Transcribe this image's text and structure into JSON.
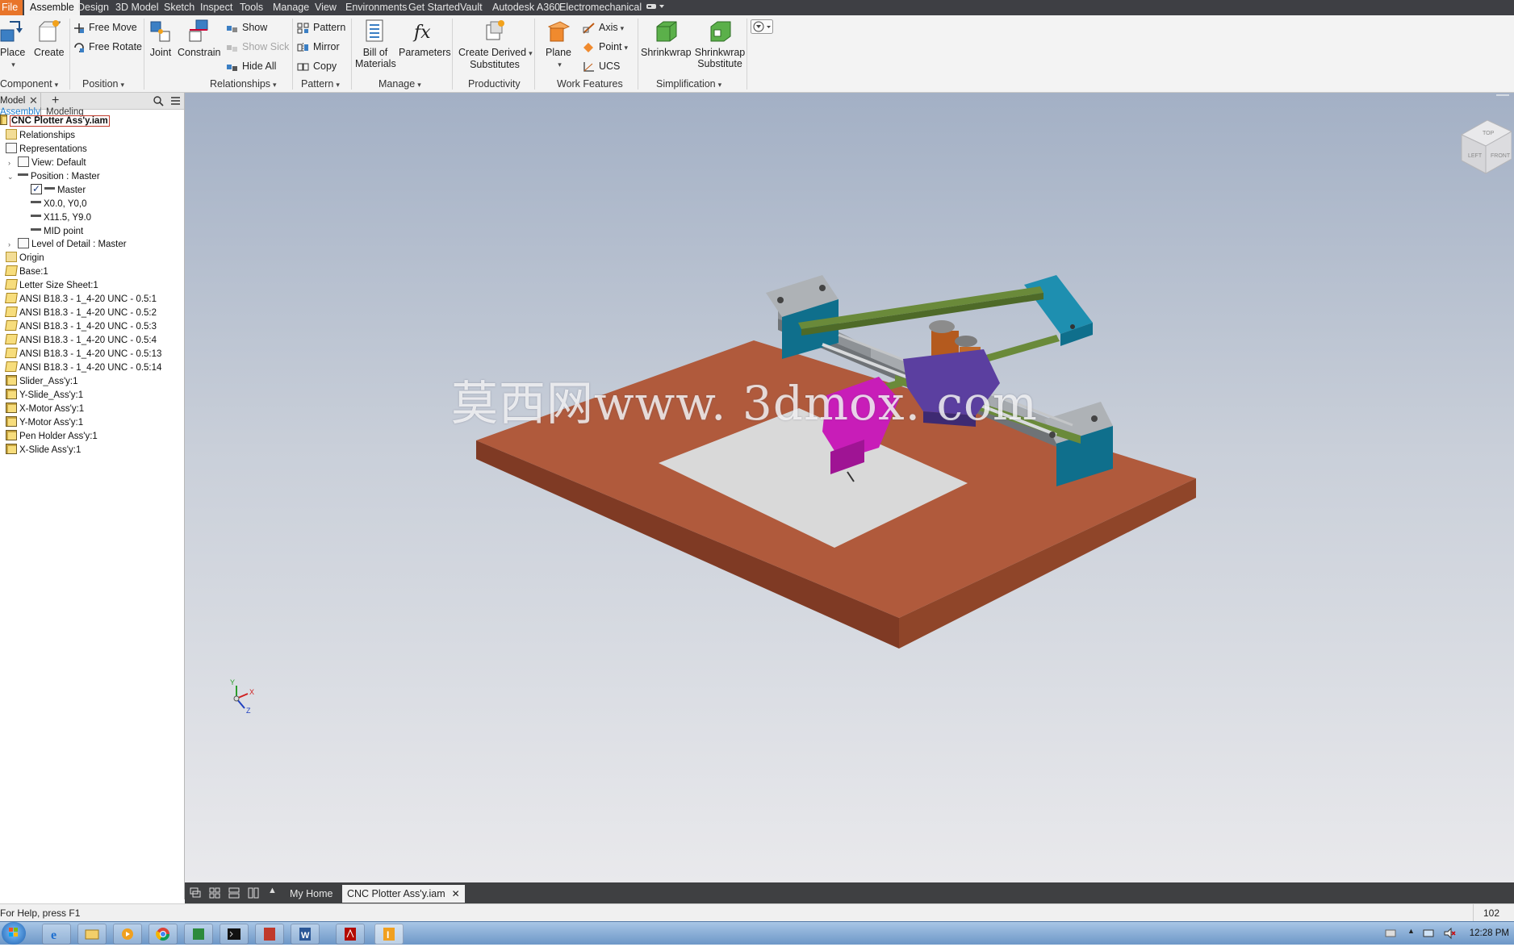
{
  "menu": {
    "tabs": [
      "File",
      "Assemble",
      "Design",
      "3D Model",
      "Sketch",
      "Inspect",
      "Tools",
      "Manage",
      "View",
      "Environments",
      "Get Started",
      "Vault",
      "Autodesk A360",
      "Electromechanical"
    ],
    "active": "Assemble"
  },
  "ribbon": {
    "component": {
      "place": "Place",
      "create": "Create",
      "group": "Component"
    },
    "position": {
      "free_move": "Free Move",
      "free_rotate": "Free Rotate",
      "group": "Position"
    },
    "relationships": {
      "joint": "Joint",
      "constrain": "Constrain",
      "show": "Show",
      "show_sick": "Show Sick",
      "hide_all": "Hide All",
      "group": "Relationships"
    },
    "pattern": {
      "pattern": "Pattern",
      "mirror": "Mirror",
      "copy": "Copy",
      "group": "Pattern"
    },
    "manage": {
      "bom_line1": "Bill of",
      "bom_line2": "Materials",
      "parameters": "Parameters",
      "group": "Manage"
    },
    "productivity": {
      "cds_line1": "Create Derived",
      "cds_line2": "Substitutes",
      "group": "Productivity"
    },
    "work_features": {
      "plane": "Plane",
      "axis": "Axis",
      "point": "Point",
      "ucs": "UCS",
      "group": "Work Features"
    },
    "simplification": {
      "shrinkwrap": "Shrinkwrap",
      "sws_line1": "Shrinkwrap",
      "sws_line2": "Substitute",
      "group": "Simplification"
    }
  },
  "browser": {
    "tab_label": "Model",
    "sub_assembly": "Assembly",
    "sub_modeling": "Modeling",
    "root": "CNC Plotter Ass'y.iam",
    "items": [
      "Relationships",
      "Representations",
      "View: Default",
      "Position : Master",
      "Master",
      "X0.0, Y0,0",
      "X11.5, Y9.0",
      "MID point",
      "Level of Detail : Master",
      "Origin",
      "Base:1",
      "Letter Size Sheet:1",
      "ANSI B18.3 - 1_4-20 UNC - 0.5:1",
      "ANSI B18.3 - 1_4-20 UNC - 0.5:2",
      "ANSI B18.3 - 1_4-20 UNC - 0.5:3",
      "ANSI B18.3 - 1_4-20 UNC - 0.5:4",
      "ANSI B18.3 - 1_4-20 UNC - 0.5:13",
      "ANSI B18.3 - 1_4-20 UNC - 0.5:14",
      "Slider_Ass'y:1",
      "Y-Slide_Ass'y:1",
      "X-Motor Ass'y:1",
      "Y-Motor Ass'y:1",
      "Pen Holder Ass'y:1",
      "X-Slide Ass'y:1"
    ]
  },
  "viewport": {
    "watermark": "莫西网www. 3dmox. com",
    "viewcube_top": "TOP",
    "viewcube_left": "LEFT",
    "viewcube_front": "FRONT",
    "axis_x": "X",
    "axis_y": "Y",
    "axis_z": "Z"
  },
  "doc_tabs": {
    "home": "My Home",
    "active": "CNC Plotter Ass'y.iam"
  },
  "status": {
    "help": "For Help, press F1",
    "count": "102"
  },
  "taskbar": {
    "clock": "12:28 PM"
  },
  "colors": {
    "file_tab": "#e8752a",
    "board": "#b05a3c",
    "sheet": "#dcdcdc",
    "rail_gray": "#9ea3a8",
    "teal": "#0f6f8c",
    "purple": "#5b3fa0",
    "magenta": "#c81db8",
    "green_rail": "#6a8a3a"
  }
}
